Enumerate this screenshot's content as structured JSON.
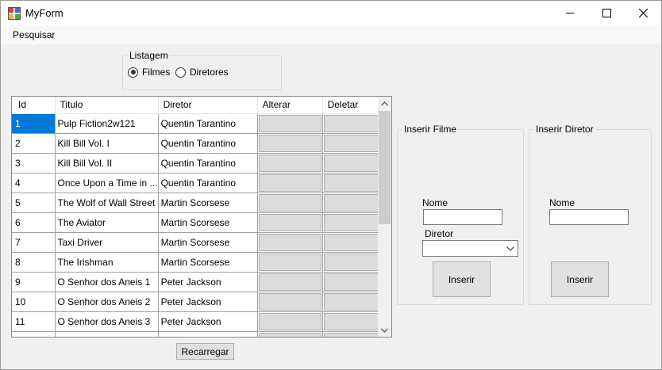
{
  "window": {
    "title": "MyForm"
  },
  "menu": {
    "items": [
      {
        "label": "Pesquisar"
      }
    ]
  },
  "listagem": {
    "legend": "Listagem",
    "options": [
      {
        "label": "Filmes",
        "checked": true
      },
      {
        "label": "Diretores",
        "checked": false
      }
    ]
  },
  "grid": {
    "columns": [
      "Id",
      "Titulo",
      "Diretor",
      "Alterar",
      "Deletar"
    ],
    "rows": [
      {
        "id": "1",
        "titulo": "Pulp Fiction2w121",
        "diretor": "Quentin Tarantino"
      },
      {
        "id": "2",
        "titulo": "Kill Bill Vol. I",
        "diretor": "Quentin Tarantino"
      },
      {
        "id": "3",
        "titulo": "Kill Bill Vol. II",
        "diretor": "Quentin Tarantino"
      },
      {
        "id": "4",
        "titulo": "Once Upon a Time in ...",
        "diretor": "Quentin Tarantino"
      },
      {
        "id": "5",
        "titulo": "The Wolf of Wall Street",
        "diretor": "Martin Scorsese"
      },
      {
        "id": "6",
        "titulo": "The Aviator",
        "diretor": "Martin Scorsese"
      },
      {
        "id": "7",
        "titulo": "Taxi Driver",
        "diretor": "Martin Scorsese"
      },
      {
        "id": "8",
        "titulo": "The Irishman",
        "diretor": "Martin Scorsese"
      },
      {
        "id": "9",
        "titulo": "O Senhor dos Aneis 1",
        "diretor": "Peter Jackson"
      },
      {
        "id": "10",
        "titulo": "O Senhor dos Aneis 2",
        "diretor": "Peter Jackson"
      },
      {
        "id": "11",
        "titulo": "O Senhor dos Aneis 3",
        "diretor": "Peter Jackson"
      }
    ]
  },
  "reload_button": "Recarregar",
  "inserir_filme": {
    "legend": "Inserir Filme",
    "nome_label": "Nome",
    "nome_value": "",
    "diretor_label": "Diretor",
    "diretor_value": "",
    "button": "Inserir"
  },
  "inserir_diretor": {
    "legend": "Inserir Diretor",
    "nome_label": "Nome",
    "nome_value": "",
    "button": "Inserir"
  },
  "colors": {
    "selection": "#0078d7",
    "window_bg": "#f0f0f0"
  }
}
